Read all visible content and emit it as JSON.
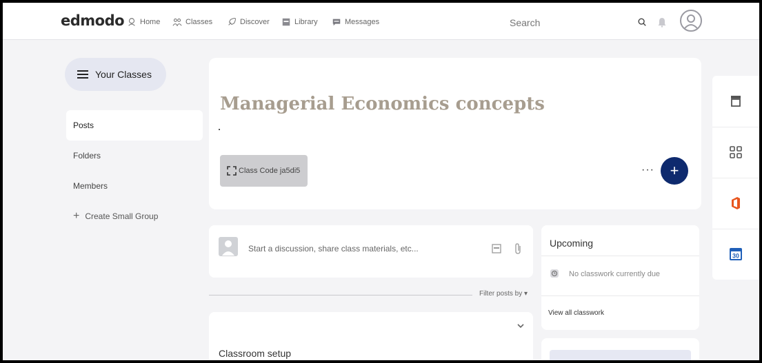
{
  "nav": {
    "logo": "edmodo",
    "items": [
      {
        "label": "Home",
        "icon": "home-icon"
      },
      {
        "label": "Classes",
        "icon": "classes-icon"
      },
      {
        "label": "Discover",
        "icon": "rocket-icon"
      },
      {
        "label": "Library",
        "icon": "library-icon"
      },
      {
        "label": "Messages",
        "icon": "messages-icon"
      }
    ],
    "search_placeholder": "Search"
  },
  "sidebar": {
    "your_classes_label": "Your Classes",
    "items": [
      {
        "label": "Posts",
        "active": true
      },
      {
        "label": "Folders",
        "active": false
      },
      {
        "label": "Members",
        "active": false
      }
    ],
    "create_group_label": "Create Small Group",
    "create_group_icon": "+"
  },
  "class_header": {
    "title": "Managerial Economics concepts",
    "class_code_label": "Class Code ja5di5",
    "more_label": "···",
    "add_label": "+"
  },
  "composer": {
    "placeholder": "Start a discussion, share class materials, etc..."
  },
  "feed": {
    "filter_label": "Filter posts by ▾",
    "setup_title": "Classroom setup"
  },
  "upcoming": {
    "title": "Upcoming",
    "empty_text": "No classwork currently due",
    "view_all_label": "View all classwork"
  },
  "rail": {
    "calendar_day": "30"
  },
  "colors": {
    "brand_navy": "#0e2a6e",
    "title_tan": "#a79d8f",
    "office_orange": "#e8561f",
    "calendar_blue": "#1f5fb8"
  }
}
